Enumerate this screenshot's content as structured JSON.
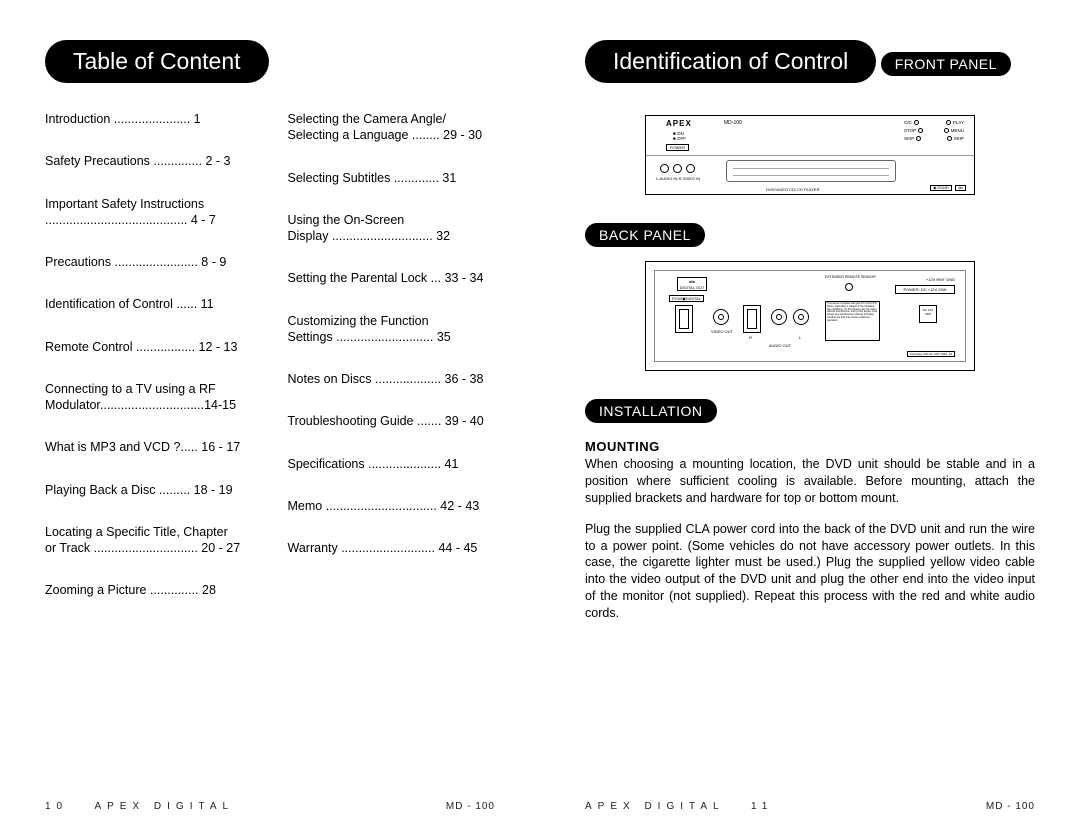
{
  "left": {
    "heading": "Table of Content",
    "toc_col1": [
      "Introduction   ......................   1",
      "Safety Precautions ..............   2 - 3",
      "Important Safety Instructions\n.........................................     4 - 7",
      "Precautions  ........................  8 - 9",
      "Identification of Control ......    11",
      "Remote Control  .................   12 - 13",
      "Connecting to a TV using a RF\nModulator..............................14-15",
      "What is MP3 and VCD ?.....  16 - 17",
      "Playing Back a Disc  .........   18 - 19",
      "Locating a Specific Title, Chapter\nor Track  ..............................    20 - 27",
      "Zooming a Picture ..............    28"
    ],
    "toc_col2": [
      "Selecting the Camera Angle/\nSelecting a Language ........    29 - 30",
      "Selecting Subtitles .............     31",
      "Using the On-Screen\nDisplay  .............................     32",
      "Setting the Parental Lock ...   33 - 34",
      "Customizing the Function\nSettings  ............................     35",
      "Notes on Discs ...................    36 - 38",
      "Troubleshooting Guide .......   39 - 40",
      "Specifications .....................    41",
      "Memo  ................................    42 - 43",
      "Warranty  ...........................    44 - 45"
    ],
    "footer_brand": "APEX  DIGITAL",
    "footer_mid": "MD - 100",
    "page_no": "10"
  },
  "right": {
    "heading": "Identification of Control",
    "front_label": "FRONT PANEL",
    "back_label": "BACK PANEL",
    "install_label": "INSTALLATION",
    "mounting_h": "MOUNTING",
    "para1": "When choosing a mounting location, the DVD unit should be stable and in a position where sufficient cooling is available.  Before mounting, attach the supplied brackets and hardware for top or bottom mount.",
    "para2": "Plug the supplied CLA power cord into the back of the DVD unit and run the wire to a power point.  (Some vehicles do not have accessory power outlets.  In this case, the cigarette lighter must be used.)  Plug the supplied yellow video cable into the video output of the DVD unit and plug the other end into the video input of the monitor (not supplied).  Repeat this process with the red and white audio cords.",
    "panel": {
      "brand": "APEX",
      "model": "MD-100",
      "power": "POWER",
      "lights_on": "■ ON",
      "lights_off": "■ OFF",
      "btn_oc": "O/C",
      "btn_play": "PLAY",
      "btn_stop": "STOP",
      "btn_menu": "MENU",
      "btn_skip1": "SKIP",
      "btn_skip2": "SKIP",
      "jacks": "L-AUDIO   IN-R     VIDEO IN",
      "tray_label": "DVD/VIDEO CD/ CD PLAYER",
      "logo1": "▣ DOLBY",
      "logo2": "dts"
    },
    "back": {
      "dts": "dts",
      "dts_sub": "DIGITAL OUT",
      "pcm": "PCM/▣DIGITAL",
      "video": "VIDEO\nOUT",
      "audio": "AUDIO OUT",
      "r": "R",
      "l": "L",
      "sensor": "EXTENDED REMOTE SENSOR",
      "pwr_top": "+12V  RMT  GND",
      "pwr_box": "POWER: DC +12V 25W",
      "dc": "DC 12V\n25W",
      "cert": "Complies with 21 CRT 1040, 10",
      "warn": "This device complies with part 15 of the FCC Rules. Operation is subject to the following two conditions: (1) this device may not cause harmful interference, and (2) this device must accept any interference received including interference that may cause undesired operation."
    },
    "footer_brand": "APEX  DIGITAL",
    "footer_mid": "MD - 100",
    "page_no": "11"
  }
}
